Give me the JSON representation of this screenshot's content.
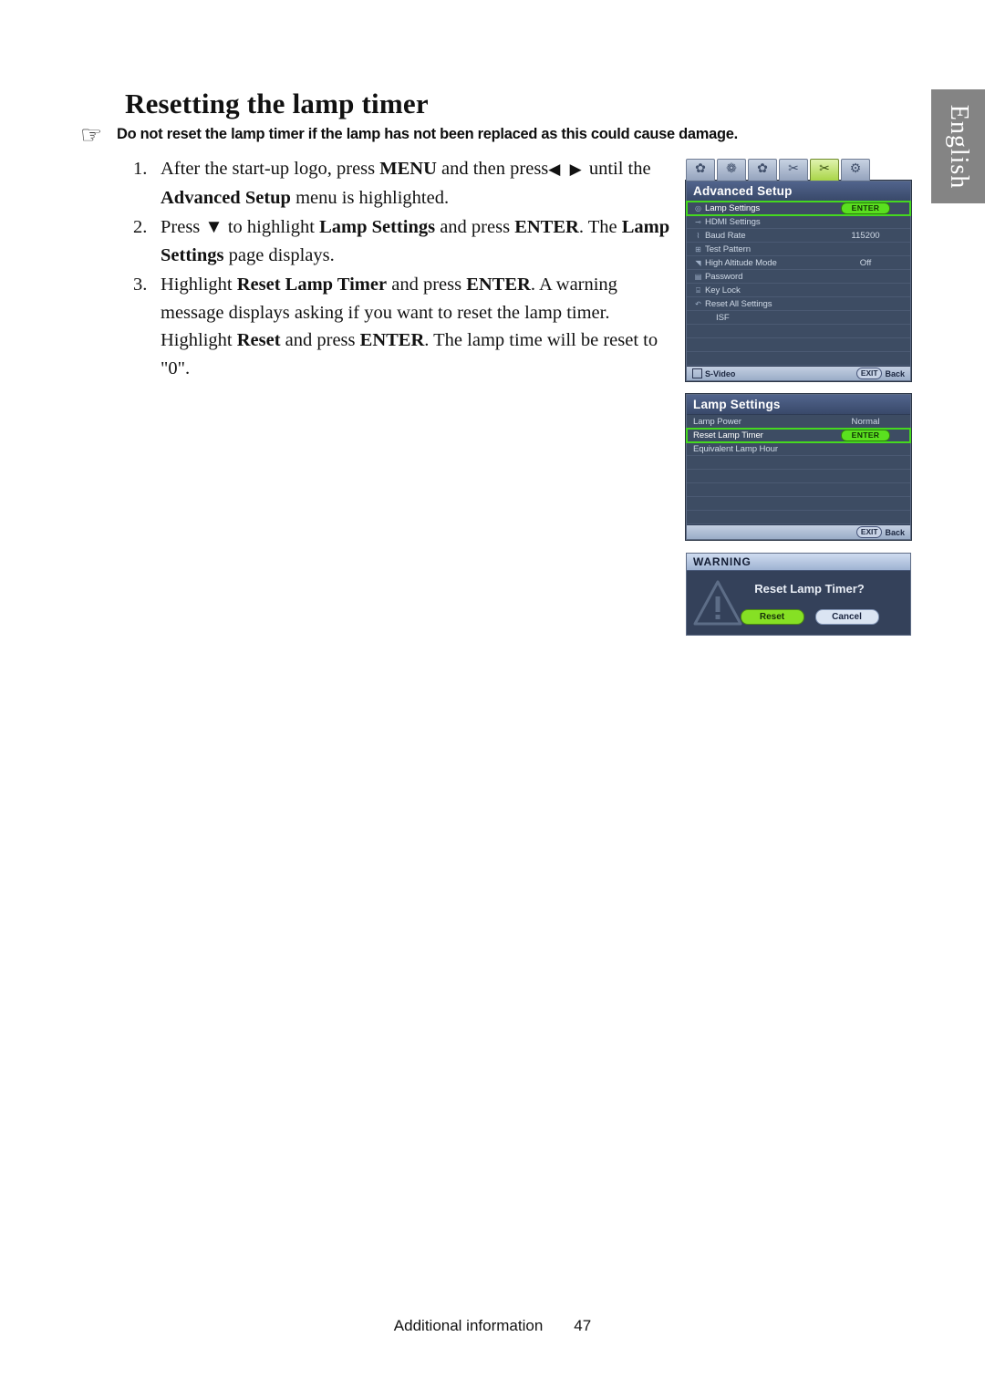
{
  "language_tab": {
    "label": "English"
  },
  "page": {
    "title": "Resetting the lamp timer",
    "footer_section": "Additional information",
    "footer_page_number": "47"
  },
  "note": {
    "icon": "pointing-hand-icon",
    "text": "Do not reset the lamp timer if the lamp has not been replaced as this could cause damage."
  },
  "steps": [
    {
      "number": "1.",
      "parts": [
        {
          "t": "After the start-up logo, press ",
          "b": false
        },
        {
          "t": "MENU",
          "b": true
        },
        {
          "t": " and then press",
          "b": false
        },
        {
          "t": "◀ ▶",
          "b": false,
          "arrow": true
        },
        {
          "t": "  until the ",
          "b": false
        },
        {
          "t": "Advanced Setup",
          "b": true
        },
        {
          "t": " menu is highlighted.",
          "b": false
        }
      ]
    },
    {
      "number": "2.",
      "parts": [
        {
          "t": "Press ▼ to highlight ",
          "b": false
        },
        {
          "t": "Lamp Settings",
          "b": true
        },
        {
          "t": " and press ",
          "b": false
        },
        {
          "t": "ENTER",
          "b": true
        },
        {
          "t": ". The ",
          "b": false
        },
        {
          "t": "Lamp Settings",
          "b": true
        },
        {
          "t": " page displays.",
          "b": false
        }
      ]
    },
    {
      "number": "3.",
      "parts": [
        {
          "t": "Highlight ",
          "b": false
        },
        {
          "t": "Reset Lamp Timer",
          "b": true
        },
        {
          "t": " and press ",
          "b": false
        },
        {
          "t": "ENTER",
          "b": true
        },
        {
          "t": ". A warning message displays asking if you want to reset the lamp timer. Highlight ",
          "b": false
        },
        {
          "t": "Reset",
          "b": true
        },
        {
          "t": " and press ",
          "b": false
        },
        {
          "t": "ENTER",
          "b": true
        },
        {
          "t": ". The lamp time will be reset to \"0\".",
          "b": false
        }
      ]
    }
  ],
  "osd": {
    "tabs": [
      {
        "name": "picture-basic-tab",
        "glyph": "✿",
        "active": false
      },
      {
        "name": "picture-advanced-tab",
        "glyph": "❁",
        "active": false
      },
      {
        "name": "display-tab",
        "glyph": "✿",
        "active": false
      },
      {
        "name": "system-setup-basic-tab",
        "glyph": "✂",
        "active": false
      },
      {
        "name": "advanced-setup-tab",
        "glyph": "✂",
        "active": true
      },
      {
        "name": "information-tab",
        "glyph": "⚙",
        "active": false
      }
    ],
    "advanced_setup": {
      "title": "Advanced Setup",
      "rows": [
        {
          "icon": "lamp-icon",
          "glyph": "◎",
          "label": "Lamp Settings",
          "value": "ENTER",
          "value_type": "badge",
          "selected": true
        },
        {
          "icon": "hdmi-icon",
          "glyph": "⊸",
          "label": "HDMI Settings",
          "value": "",
          "value_type": "text",
          "selected": false
        },
        {
          "icon": "baud-icon",
          "glyph": "⌇",
          "label": "Baud Rate",
          "value": "115200",
          "value_type": "text",
          "selected": false
        },
        {
          "icon": "grid-icon",
          "glyph": "⊞",
          "label": "Test Pattern",
          "value": "",
          "value_type": "text",
          "selected": false
        },
        {
          "icon": "altitude-icon",
          "glyph": "◥",
          "label": "High Altitude Mode",
          "value": "Off",
          "value_type": "text",
          "selected": false
        },
        {
          "icon": "lock-icon",
          "glyph": "▤",
          "label": "Password",
          "value": "",
          "value_type": "text",
          "selected": false
        },
        {
          "icon": "keypad-icon",
          "glyph": "⌸",
          "label": "Key Lock",
          "value": "",
          "value_type": "text",
          "selected": false
        },
        {
          "icon": "reset-icon",
          "glyph": "↶",
          "label": "Reset All Settings",
          "value": "",
          "value_type": "text",
          "selected": false
        },
        {
          "icon": "",
          "glyph": "",
          "label": "ISF",
          "value": "",
          "value_type": "text",
          "selected": false,
          "indent": true
        }
      ],
      "footer": {
        "source_icon": "input-source-icon",
        "source_label": "S-Video",
        "exit_key": "EXIT",
        "exit_label": "Back"
      }
    },
    "lamp_settings": {
      "title": "Lamp Settings",
      "rows": [
        {
          "label": "Lamp Power",
          "value": "Normal",
          "value_type": "text",
          "selected": false
        },
        {
          "label": "Reset Lamp Timer",
          "value": "ENTER",
          "value_type": "badge",
          "selected": true
        },
        {
          "label": "Equivalent Lamp Hour",
          "value": "",
          "value_type": "text",
          "selected": false
        }
      ],
      "footer": {
        "exit_key": "EXIT",
        "exit_label": "Back"
      }
    },
    "warning_dialog": {
      "title": "WARNING",
      "icon": "warning-triangle-icon",
      "message": "Reset Lamp Timer?",
      "confirm_label": "Reset",
      "cancel_label": "Cancel"
    }
  },
  "colors": {
    "osd_panel_bg": "#3d4c63",
    "osd_header_bg": "#39496a",
    "highlight_green": "#45d81f",
    "enter_badge_green": "#5ae01f",
    "reset_button_green": "#86e024",
    "cancel_button_bg": "#dbe5f3",
    "footer_bar_bg": "#9badc7",
    "lang_tab_bg": "#848484"
  }
}
